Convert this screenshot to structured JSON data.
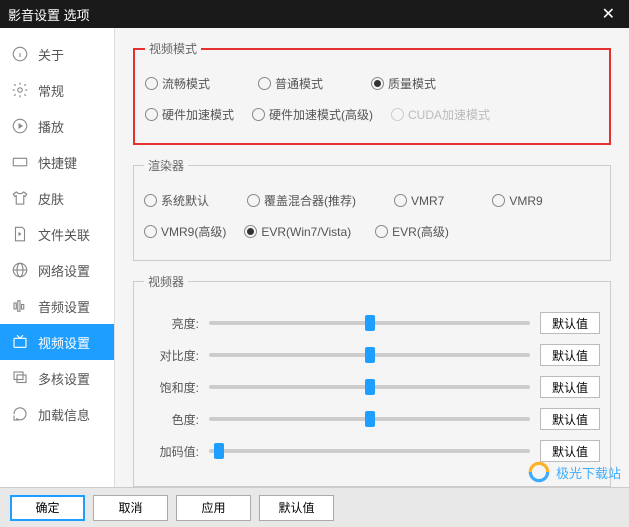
{
  "title": "影音设置 选项",
  "sidebar": {
    "items": [
      {
        "label": "关于"
      },
      {
        "label": "常规"
      },
      {
        "label": "播放"
      },
      {
        "label": "快捷键"
      },
      {
        "label": "皮肤"
      },
      {
        "label": "文件关联"
      },
      {
        "label": "网络设置"
      },
      {
        "label": "音频设置"
      },
      {
        "label": "视频设置"
      },
      {
        "label": "多核设置"
      },
      {
        "label": "加载信息"
      }
    ]
  },
  "video_mode": {
    "legend": "视频模式",
    "opts": {
      "smooth": "流畅模式",
      "normal": "普通模式",
      "quality": "质量模式",
      "hw": "硬件加速模式",
      "hw_adv": "硬件加速模式(高级)",
      "cuda": "CUDA加速模式"
    }
  },
  "renderer": {
    "legend": "渲染器",
    "opts": {
      "sys": "系统默认",
      "overlay": "覆盖混合器(推荐)",
      "vmr7": "VMR7",
      "vmr9": "VMR9",
      "vmr9a": "VMR9(高级)",
      "evr": "EVR(Win7/Vista)",
      "evra": "EVR(高级)"
    }
  },
  "adjuster": {
    "legend": "视频器",
    "sliders": {
      "brightness": {
        "label": "亮度:",
        "pos": 50
      },
      "contrast": {
        "label": "对比度:",
        "pos": 50
      },
      "saturation": {
        "label": "饱和度:",
        "pos": 50
      },
      "hue": {
        "label": "色度:",
        "pos": 50
      },
      "gamma": {
        "label": "加码值:",
        "pos": 3
      }
    },
    "default_btn": "默认值"
  },
  "footer": {
    "ok": "确定",
    "cancel": "取消",
    "apply": "应用",
    "default": "默认值"
  },
  "watermark": "极光下载站"
}
